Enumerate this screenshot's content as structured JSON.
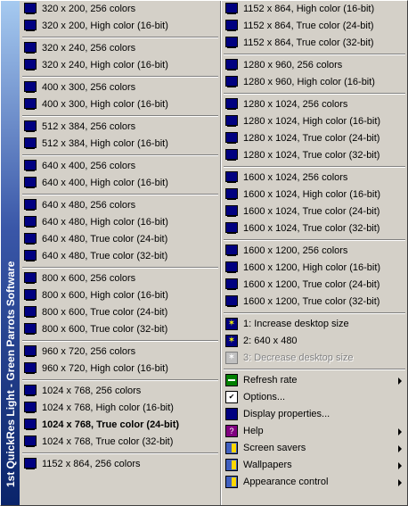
{
  "sidebar_text": "1st QuickRes Light  -  Green Parrots Software",
  "column1": [
    {
      "type": "group",
      "items": [
        "320 x 200, 256 colors",
        "320 x 200, High color (16-bit)"
      ]
    },
    {
      "type": "group",
      "items": [
        "320 x 240, 256 colors",
        "320 x 240, High color (16-bit)"
      ]
    },
    {
      "type": "group",
      "items": [
        "400 x 300, 256 colors",
        "400 x 300, High color (16-bit)"
      ]
    },
    {
      "type": "group",
      "items": [
        "512 x 384, 256 colors",
        "512 x 384, High color (16-bit)"
      ]
    },
    {
      "type": "group",
      "items": [
        "640 x 400, 256 colors",
        "640 x 400, High color (16-bit)"
      ]
    },
    {
      "type": "group",
      "items": [
        "640 x 480, 256 colors",
        "640 x 480, High color (16-bit)",
        "640 x 480, True color (24-bit)",
        "640 x 480, True color (32-bit)"
      ]
    },
    {
      "type": "group",
      "items": [
        "800 x 600, 256 colors",
        "800 x 600, High color (16-bit)",
        "800 x 600, True color (24-bit)",
        "800 x 600, True color (32-bit)"
      ]
    },
    {
      "type": "group",
      "items": [
        "960 x 720, 256 colors",
        "960 x 720, High color (16-bit)"
      ]
    },
    {
      "type": "group",
      "items": [
        "1024 x 768, 256 colors",
        "1024 x 768, High color (16-bit)",
        "1024 x 768, True color (24-bit)",
        "1024 x 768, True color (32-bit)"
      ],
      "bold_index": 2
    },
    {
      "type": "group",
      "items": [
        "1152 x 864, 256 colors"
      ]
    }
  ],
  "column2_resolutions": [
    {
      "items": [
        "1152 x 864, High color (16-bit)",
        "1152 x 864, True color (24-bit)",
        "1152 x 864, True color (32-bit)"
      ]
    },
    {
      "items": [
        "1280 x 960, 256 colors",
        "1280 x 960, High color (16-bit)"
      ]
    },
    {
      "items": [
        "1280 x 1024, 256 colors",
        "1280 x 1024, High color (16-bit)",
        "1280 x 1024, True color (24-bit)",
        "1280 x 1024, True color (32-bit)"
      ]
    },
    {
      "items": [
        "1600 x 1024, 256 colors",
        "1600 x 1024, High color (16-bit)",
        "1600 x 1024, True color (24-bit)",
        "1600 x 1024, True color (32-bit)"
      ]
    },
    {
      "items": [
        "1600 x 1200, 256 colors",
        "1600 x 1200, High color (16-bit)",
        "1600 x 1200, True color (24-bit)",
        "1600 x 1200, True color (32-bit)"
      ]
    }
  ],
  "desktop_size": [
    {
      "label": "1: Increase desktop size",
      "icon": "sun-icon",
      "disabled": false
    },
    {
      "label": "2: 640 x 480",
      "icon": "sun-icon",
      "disabled": false
    },
    {
      "label": "3: Decrease desktop size",
      "icon": "sun-icon",
      "disabled": true
    }
  ],
  "commands": [
    {
      "label": "Refresh rate",
      "icon": "refresh-rate-icon",
      "cls": "rate",
      "submenu": true
    },
    {
      "label": "Options...",
      "icon": "options-icon",
      "cls": "opts",
      "submenu": false
    },
    {
      "label": "Display properties...",
      "icon": "display-properties-icon",
      "cls": "disp",
      "submenu": false
    },
    {
      "label": "Help",
      "icon": "help-book-icon",
      "cls": "help",
      "submenu": true
    },
    {
      "label": "Screen savers",
      "icon": "screen-savers-icon",
      "cls": "cube",
      "submenu": true
    },
    {
      "label": "Wallpapers",
      "icon": "wallpapers-icon",
      "cls": "cube",
      "submenu": true
    },
    {
      "label": "Appearance control",
      "icon": "appearance-control-icon",
      "cls": "cube",
      "submenu": true
    }
  ]
}
